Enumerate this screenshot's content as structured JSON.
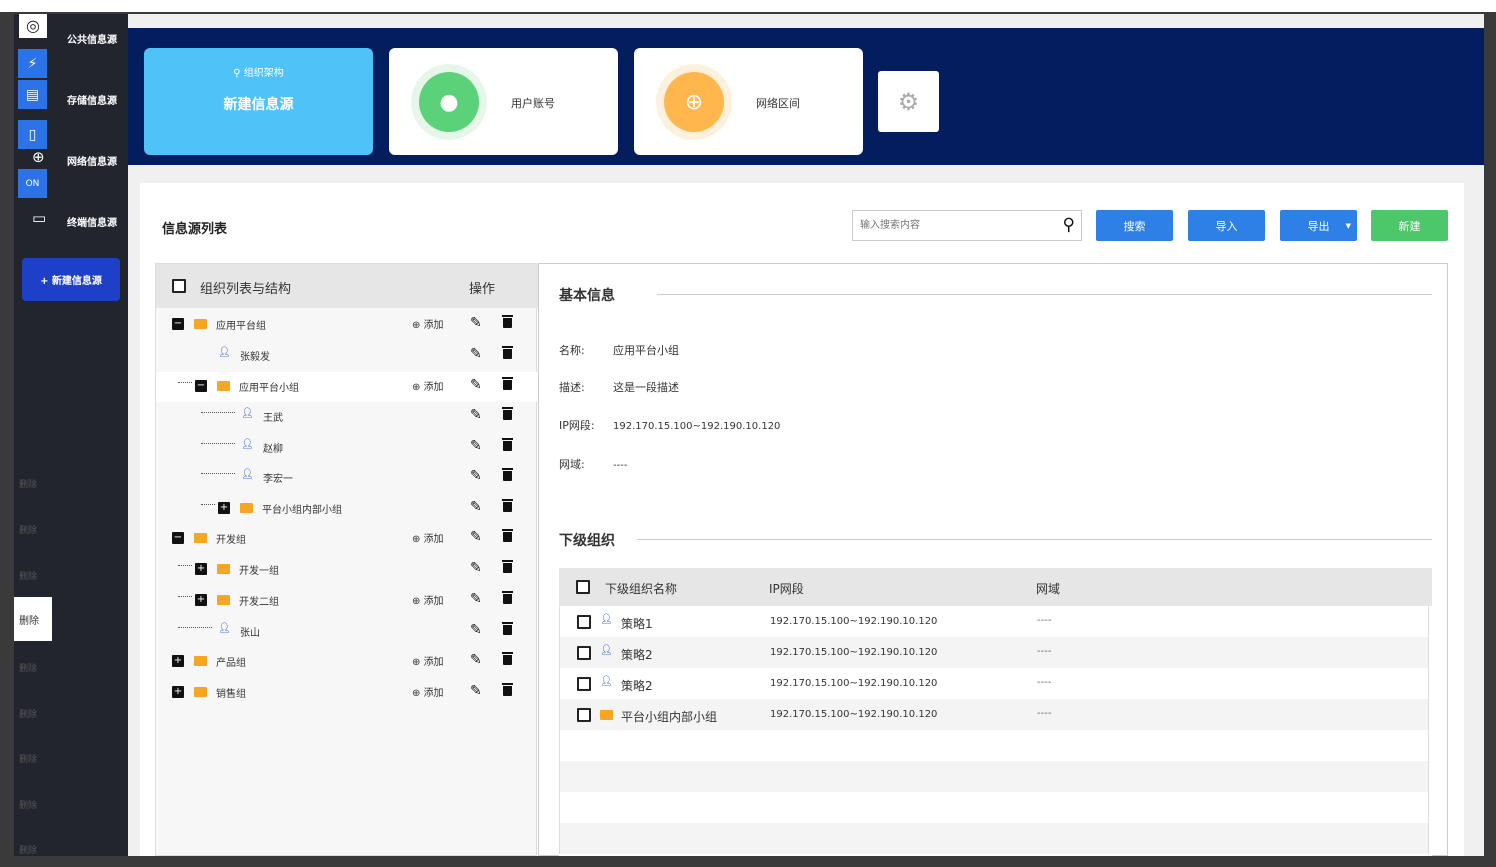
{
  "sidebar": {
    "nav": [
      {
        "label": "公共信息源",
        "icon": "target-icon"
      },
      {
        "label": "存储信息源",
        "icon": "document-icon"
      },
      {
        "label": "网络信息源",
        "icon": "globe-icon"
      },
      {
        "label": "终端信息源",
        "icon": "monitor-icon"
      }
    ],
    "new_button": "+ 新建信息源",
    "delete_items": [
      "删除",
      "删除",
      "删除",
      "删除",
      "删除",
      "删除",
      "删除",
      "删除",
      "删除"
    ]
  },
  "header": {
    "new_card": {
      "crumb": "组织架构",
      "title": "新建信息源"
    },
    "user_card": {
      "label": "用户账号",
      "color": "#5bd27a"
    },
    "network_card": {
      "label": "网络区间",
      "color": "#ffb74d"
    }
  },
  "toolbar": {
    "title": "信息源列表",
    "search_placeholder": "输入搜索内容",
    "search_label": "搜索",
    "import_label": "导入",
    "export_label": "导出",
    "export_caret": "▼",
    "new_label": "新建"
  },
  "tree": {
    "header_label": "组织列表与结构",
    "ops_label": "操作",
    "add_label": "添加",
    "rows": [
      {
        "name": "应用平台组",
        "type": "group",
        "toggle": "−",
        "add": true
      },
      {
        "name": "张毅发",
        "type": "user",
        "add": false
      },
      {
        "name": "应用平台小组",
        "type": "group",
        "toggle": "−",
        "add": true
      },
      {
        "name": "王武",
        "type": "user",
        "add": false
      },
      {
        "name": "赵柳",
        "type": "user",
        "add": false
      },
      {
        "name": "李宏一",
        "type": "user",
        "add": false
      },
      {
        "name": "平台小组内部小组",
        "type": "group",
        "toggle": "+",
        "add": false
      },
      {
        "name": "开发组",
        "type": "group",
        "toggle": "−",
        "add": true
      },
      {
        "name": "开发一组",
        "type": "group",
        "toggle": "+",
        "add": false
      },
      {
        "name": "开发二组",
        "type": "group",
        "toggle": "+",
        "add": true
      },
      {
        "name": "张山",
        "type": "user",
        "add": false
      },
      {
        "name": "产品组",
        "type": "group",
        "toggle": "+",
        "add": true
      },
      {
        "name": "销售组",
        "type": "group",
        "toggle": "+",
        "add": true
      }
    ]
  },
  "detail": {
    "basic_title": "基本信息",
    "name_key": "名称:",
    "name_value": "应用平台小组",
    "desc_key": "描述:",
    "desc_value": "这是一段描述",
    "ip_key": "IP网段:",
    "ip_value": "192.170.15.100~192.190.10.120",
    "domain_key": "网域:",
    "domain_value": "----",
    "sub_title": "下级组织",
    "sub_headers": {
      "name": "下级组织名称",
      "ip": "IP网段",
      "domain": "网域"
    },
    "sub_rows": [
      {
        "name": "策略1",
        "type": "user",
        "ip": "192.170.15.100~192.190.10.120",
        "domain": "----"
      },
      {
        "name": "策略2",
        "type": "user",
        "ip": "192.170.15.100~192.190.10.120",
        "domain": "----"
      },
      {
        "name": "策略2",
        "type": "user",
        "ip": "192.170.15.100~192.190.10.120",
        "domain": "----"
      },
      {
        "name": "平台小组内部小组",
        "type": "group",
        "ip": "192.170.15.100~192.190.10.120",
        "domain": "----"
      }
    ]
  }
}
